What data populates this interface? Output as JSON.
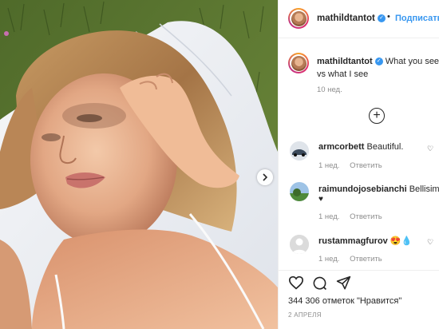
{
  "post": {
    "author": "mathildtantot",
    "follow_label": "Подписаться",
    "separator": "•"
  },
  "caption": {
    "author": "mathildtantot",
    "text": "What you see vs what I see",
    "time": "10 нед."
  },
  "comments": [
    {
      "user": "armcorbett",
      "text": "Beautiful.",
      "time": "1 нед.",
      "reply_label": "Ответить"
    },
    {
      "user": "raimundojosebianchi",
      "text": "Bellisima😍",
      "second_line": "♥",
      "time": "1 нед.",
      "reply_label": "Ответить"
    },
    {
      "user": "rustammagfurov",
      "text": "😍💧",
      "time": "1 нед.",
      "reply_label": "Ответить"
    }
  ],
  "actions": {
    "like_icon": "heart-icon",
    "comment_icon": "comment-icon",
    "share_icon": "share-icon",
    "likes_text": "344 306 отметок \"Нравится\"",
    "date": "2 апреля"
  },
  "load_more_label": "+",
  "colors": {
    "link_blue": "#3897f0",
    "text": "#262626",
    "muted": "#8e8e8e",
    "border": "#efefef"
  }
}
